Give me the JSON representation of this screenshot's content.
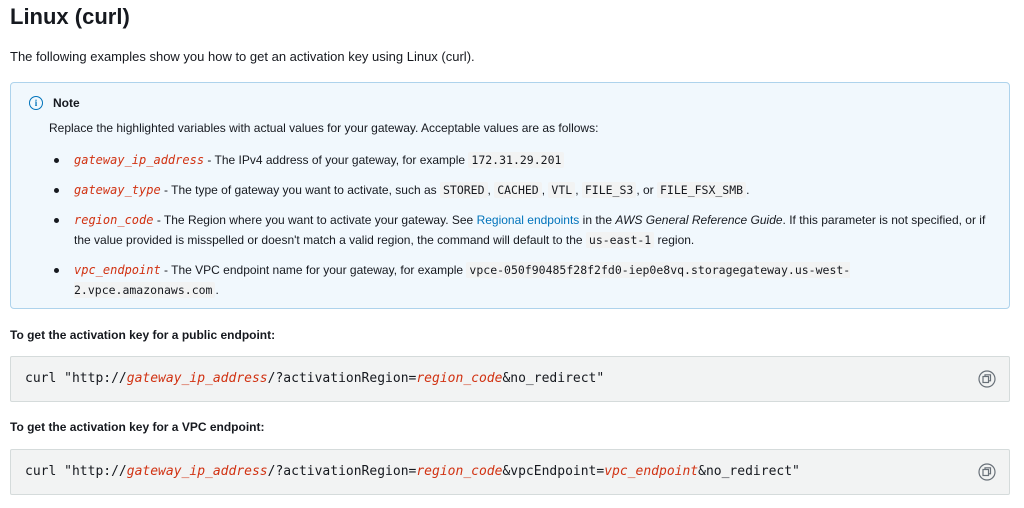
{
  "title": "Linux (curl)",
  "intro": "The following examples show you how to get an activation key using Linux (curl).",
  "note": {
    "title": "Note",
    "text": "Replace the highlighted variables with actual values for your gateway. Acceptable values are as follows:",
    "items": [
      {
        "var": "gateway_ip_address",
        "text": " - The IPv4 address of your gateway, for example ",
        "code": "172.31.29.201"
      },
      {
        "var": "gateway_type",
        "text": " - The type of gateway you want to activate, such as ",
        "codes": [
          "STORED",
          "CACHED",
          "VTL",
          "FILE_S3"
        ],
        "or": ", or ",
        "last_code": "FILE_FSX_SMB",
        "end": "."
      },
      {
        "var": "region_code",
        "text": " - The Region where you want to activate your gateway. See ",
        "link": "Regional endpoints",
        "mid": " in the ",
        "guide": "AWS General Reference Guide",
        "rest": ". If this parameter is not specified, or if the value provided is misspelled or doesn't match a valid region, the command will default to the ",
        "code": "us-east-1",
        "end": " region."
      },
      {
        "var": "vpc_endpoint",
        "text": " - The VPC endpoint name for your gateway, for example ",
        "code": "vpce-050f90485f28f2fd0-iep0e8vq.storagegateway.us-west-2.vpce.amazonaws.com",
        "end": "."
      }
    ]
  },
  "public": {
    "heading": "To get the activation key for a public endpoint:",
    "code": {
      "p1": "curl \"http://",
      "v1": "gateway_ip_address",
      "p2": "/?activationRegion=",
      "v2": "region_code",
      "p3": "&no_redirect\""
    }
  },
  "vpc": {
    "heading": "To get the activation key for a VPC endpoint:",
    "code": {
      "p1": "curl \"http://",
      "v1": "gateway_ip_address",
      "p2": "/?activationRegion=",
      "v2": "region_code",
      "p3": "&vpcEndpoint=",
      "v3": "vpc_endpoint",
      "p4": "&no_redirect\""
    }
  },
  "icons": {
    "info": "info-icon",
    "copy": "copy-icon"
  },
  "colors": {
    "variable": "#d13212",
    "link": "#0073bb",
    "note_bg": "#f1f8fd",
    "note_border": "#aed3ec",
    "code_bg": "#f2f3f3"
  }
}
